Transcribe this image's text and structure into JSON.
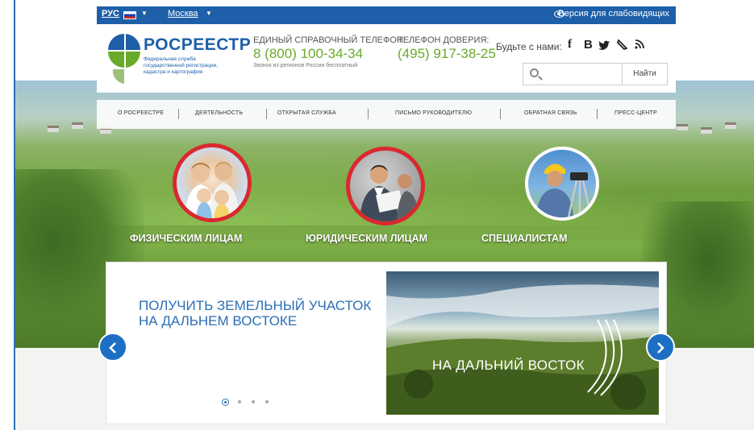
{
  "topbar": {
    "lang": "РУС",
    "city": "Москва",
    "accessible_version": "Версия для слабовидящих"
  },
  "header": {
    "logo_title": "РОСРЕЕСТР",
    "logo_subtitle": "Федеральная служба государственной регистрации, кадастра и картографии",
    "hotline_label": "ЕДИНЫЙ СПРАВОЧНЫЙ ТЕЛЕФОН:",
    "hotline_number": "8 (800) 100-34-34",
    "hotline_note": "Звонок из регионов России бесплатный",
    "trust_label": "ТЕЛЕФОН ДОВЕРИЯ:",
    "trust_number": "(495) 917-38-25",
    "social_label": "Будьте с нами:",
    "search_button": "Найти",
    "search_placeholder": ""
  },
  "nav": {
    "items": [
      {
        "label": "О РОСРЕЕСТРЕ"
      },
      {
        "label": "ДЕЯТЕЛЬНОСТЬ"
      },
      {
        "label": "ОТКРЫТАЯ СЛУЖБА"
      },
      {
        "label": "ПИСЬМО РУКОВОДИТЕЛЮ"
      },
      {
        "label": "ОБРАТНАЯ СВЯЗЬ"
      },
      {
        "label": "ПРЕСС-ЦЕНТР"
      }
    ]
  },
  "categories": [
    {
      "label": "ФИЗИЧЕСКИМ ЛИЦАМ",
      "ring": "#d9292f"
    },
    {
      "label": "ЮРИДИЧЕСКИМ ЛИЦАМ",
      "ring": "#d9292f"
    },
    {
      "label": "СПЕЦИАЛИСТАМ",
      "ring": "#ffffff"
    }
  ],
  "slider": {
    "title": "ПОЛУЧИТЬ ЗЕМЕЛЬНЫЙ УЧАСТОК НА ДАЛЬНЕМ ВОСТОКЕ",
    "image_text": "НА ДАЛЬНИЙ ВОСТОК",
    "slide_count": 4,
    "active_slide": 1
  },
  "colors": {
    "brand_blue": "#1d5fa8",
    "phone_green": "#6aaa2b",
    "arrow_blue": "#1d6fc4"
  },
  "icons": [
    "flag-ru-icon",
    "eye-icon",
    "facebook-icon",
    "vk-icon",
    "twitter-icon",
    "livejournal-icon",
    "rss-icon",
    "search-icon",
    "chevron-left-icon",
    "chevron-right-icon"
  ]
}
